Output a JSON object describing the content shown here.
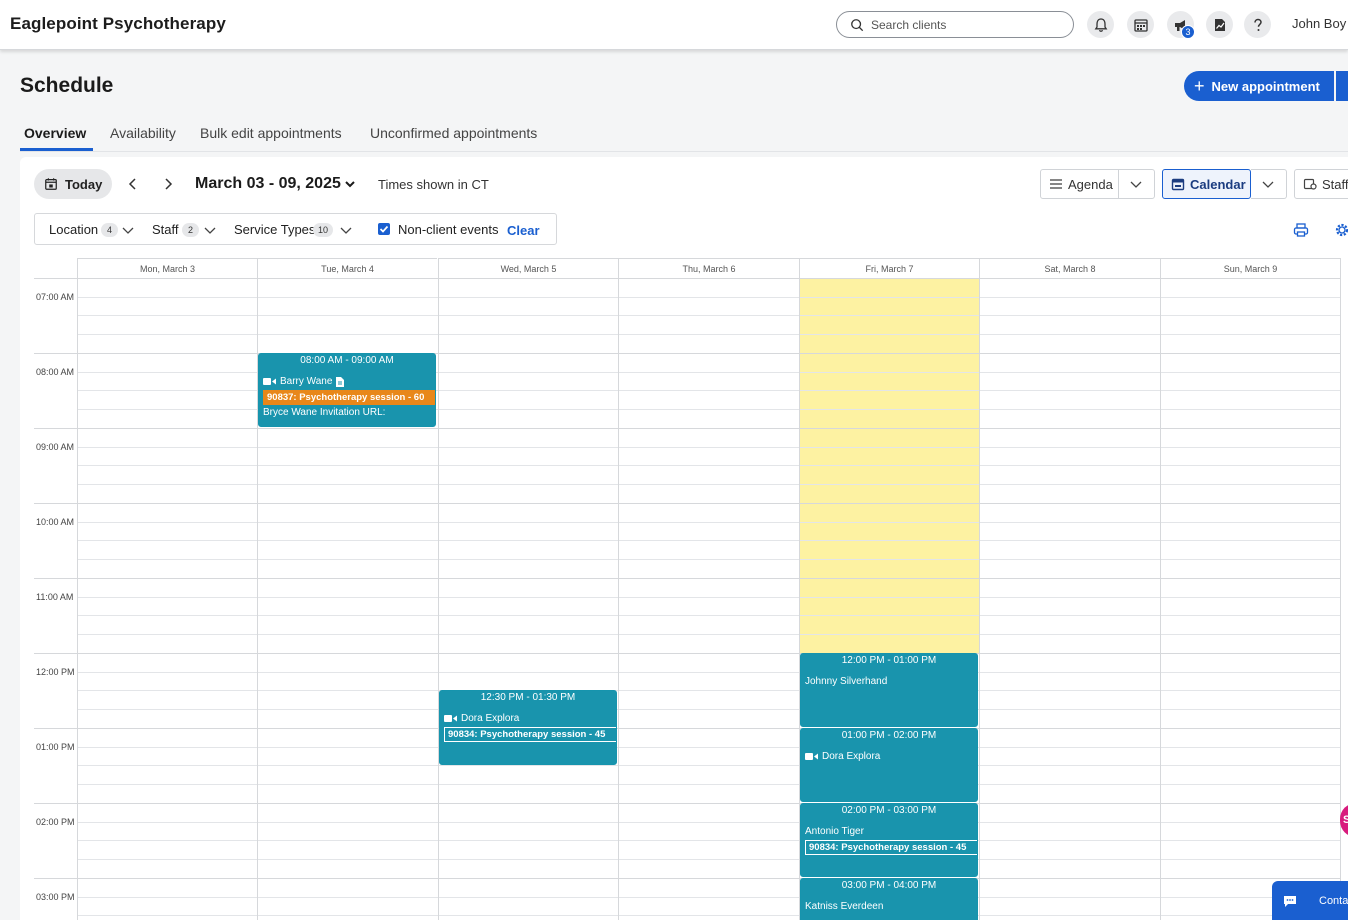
{
  "app": {
    "brand": "Eaglepoint Psychotherapy",
    "user": "John Boy"
  },
  "search": {
    "placeholder": "Search clients"
  },
  "notifications": {
    "announcements_count": "3"
  },
  "page": {
    "title": "Schedule",
    "new_appointment": "New appointment"
  },
  "tabs": [
    {
      "label": "Overview"
    },
    {
      "label": "Availability"
    },
    {
      "label": "Bulk edit appointments"
    },
    {
      "label": "Unconfirmed appointments"
    }
  ],
  "toolbar": {
    "today": "Today",
    "range": "March 03 - 09, 2025",
    "timezone": "Times shown in CT",
    "agenda": "Agenda",
    "calendar": "Calendar",
    "staff": "Staff"
  },
  "filters": {
    "location": {
      "label": "Location",
      "count": "4"
    },
    "staff": {
      "label": "Staff",
      "count": "2"
    },
    "service_types": {
      "label": "Service Types",
      "count": "10"
    },
    "non_client": "Non-client events",
    "clear": "Clear"
  },
  "days": [
    "Mon, March 3",
    "Tue, March 4",
    "Wed, March 5",
    "Thu, March 6",
    "Fri, March 7",
    "Sat, March 8",
    "Sun, March 9"
  ],
  "times": [
    "07:00 AM",
    "08:00 AM",
    "09:00 AM",
    "10:00 AM",
    "11:00 AM",
    "12:00 PM",
    "01:00 PM",
    "02:00 PM",
    "03:00 PM"
  ],
  "appointments": [
    {
      "time": "08:00 AM - 09:00 AM",
      "client": "Barry Wane",
      "service": "90837: Psychotherapy session - 60",
      "note": "Bryce Wane Invitation URL:"
    },
    {
      "time": "12:30 PM - 01:30 PM",
      "client": "Dora Explora",
      "service": "90834: Psychotherapy session - 45"
    },
    {
      "time": "12:00 PM - 01:00 PM",
      "client": "Johnny Silverhand"
    },
    {
      "time": "01:00 PM - 02:00 PM",
      "client": "Dora Explora"
    },
    {
      "time": "02:00 PM - 03:00 PM",
      "client": "Antonio Tiger",
      "service": "90834: Psychotherapy session - 45"
    },
    {
      "time": "03:00 PM - 04:00 PM",
      "client": "Katniss Everdeen"
    }
  ],
  "chat": {
    "label": "Contact"
  },
  "side_bubble": "S",
  "colors": {
    "accent": "#1a5fd0",
    "appointment": "#1994ad",
    "highlight": "#fdf2a2",
    "service_tag": "#e8871a"
  }
}
